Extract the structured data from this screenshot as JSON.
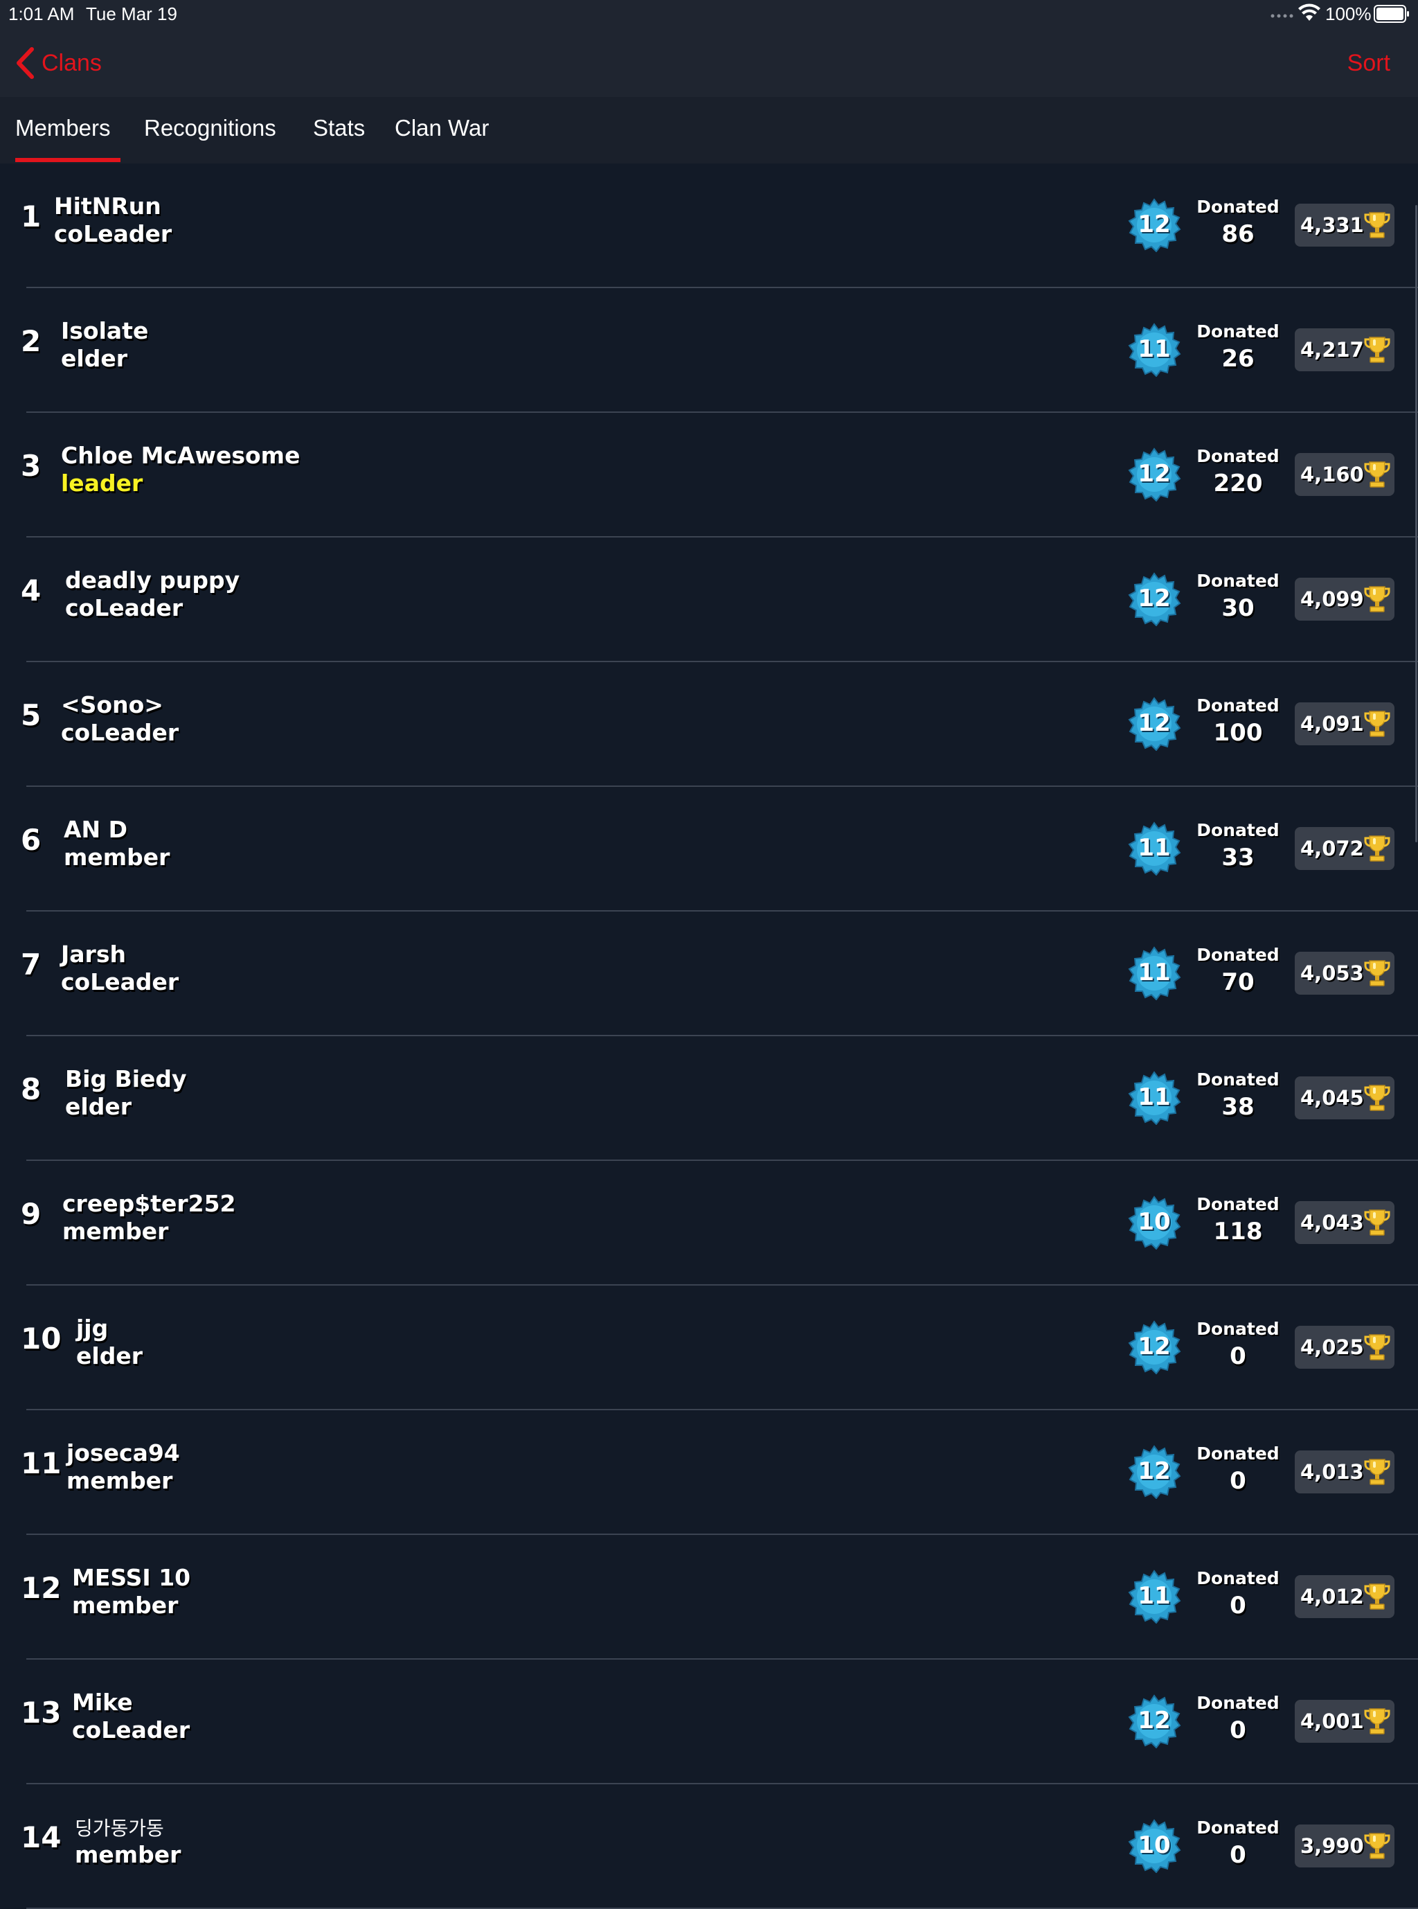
{
  "status_bar": {
    "time": "1:01 AM",
    "date": "Tue Mar 19",
    "battery_pct": "100%"
  },
  "nav": {
    "back_label": "Clans",
    "sort_label": "Sort"
  },
  "tabs": [
    {
      "label": "Members",
      "active": true
    },
    {
      "label": "Recognitions",
      "active": false
    },
    {
      "label": "Stats",
      "active": false
    },
    {
      "label": "Clan War",
      "active": false
    }
  ],
  "members_header": {
    "donated_label": "Donated"
  },
  "members": [
    {
      "rank": "1",
      "name": "HitNRun",
      "role": "coLeader",
      "level": "12",
      "donated": "86",
      "trophies": "4,331"
    },
    {
      "rank": "2",
      "name": "Isolate",
      "role": "elder",
      "level": "11",
      "donated": "26",
      "trophies": "4,217"
    },
    {
      "rank": "3",
      "name": "Chloe McAwesome",
      "role": "leader",
      "level": "12",
      "donated": "220",
      "trophies": "4,160"
    },
    {
      "rank": "4",
      "name": "deadly puppy",
      "role": "coLeader",
      "level": "12",
      "donated": "30",
      "trophies": "4,099"
    },
    {
      "rank": "5",
      "name": "<Sono>",
      "role": "coLeader",
      "level": "12",
      "donated": "100",
      "trophies": "4,091"
    },
    {
      "rank": "6",
      "name": "AN D",
      "role": "member",
      "level": "11",
      "donated": "33",
      "trophies": "4,072"
    },
    {
      "rank": "7",
      "name": "Jarsh",
      "role": "coLeader",
      "level": "11",
      "donated": "70",
      "trophies": "4,053"
    },
    {
      "rank": "8",
      "name": "Big Biedy",
      "role": "elder",
      "level": "11",
      "donated": "38",
      "trophies": "4,045"
    },
    {
      "rank": "9",
      "name": "creep$ter252",
      "role": "member",
      "level": "10",
      "donated": "118",
      "trophies": "4,043"
    },
    {
      "rank": "10",
      "name": "jjg",
      "role": "elder",
      "level": "12",
      "donated": "0",
      "trophies": "4,025"
    },
    {
      "rank": "11",
      "name": "joseca94",
      "role": "member",
      "level": "12",
      "donated": "0",
      "trophies": "4,013"
    },
    {
      "rank": "12",
      "name": "MESSI 10",
      "role": "member",
      "level": "11",
      "donated": "0",
      "trophies": "4,012"
    },
    {
      "rank": "13",
      "name": "Mike",
      "role": "coLeader",
      "level": "12",
      "donated": "0",
      "trophies": "4,001"
    },
    {
      "rank": "14",
      "name": "딩가동가동",
      "role": "member",
      "level": "10",
      "donated": "0",
      "trophies": "3,990"
    }
  ],
  "colors": {
    "accent": "#e3141c",
    "leader_role": "#f8f223",
    "background": "#121a27",
    "level_badge": "#2b9fd1",
    "trophy_box": "#3a404b"
  },
  "icons": {
    "back": "chevron-left-icon",
    "trophy": "trophy-icon",
    "level": "level-badge-icon",
    "wifi": "wifi-icon",
    "battery": "battery-icon",
    "signal": "signal-icon"
  }
}
